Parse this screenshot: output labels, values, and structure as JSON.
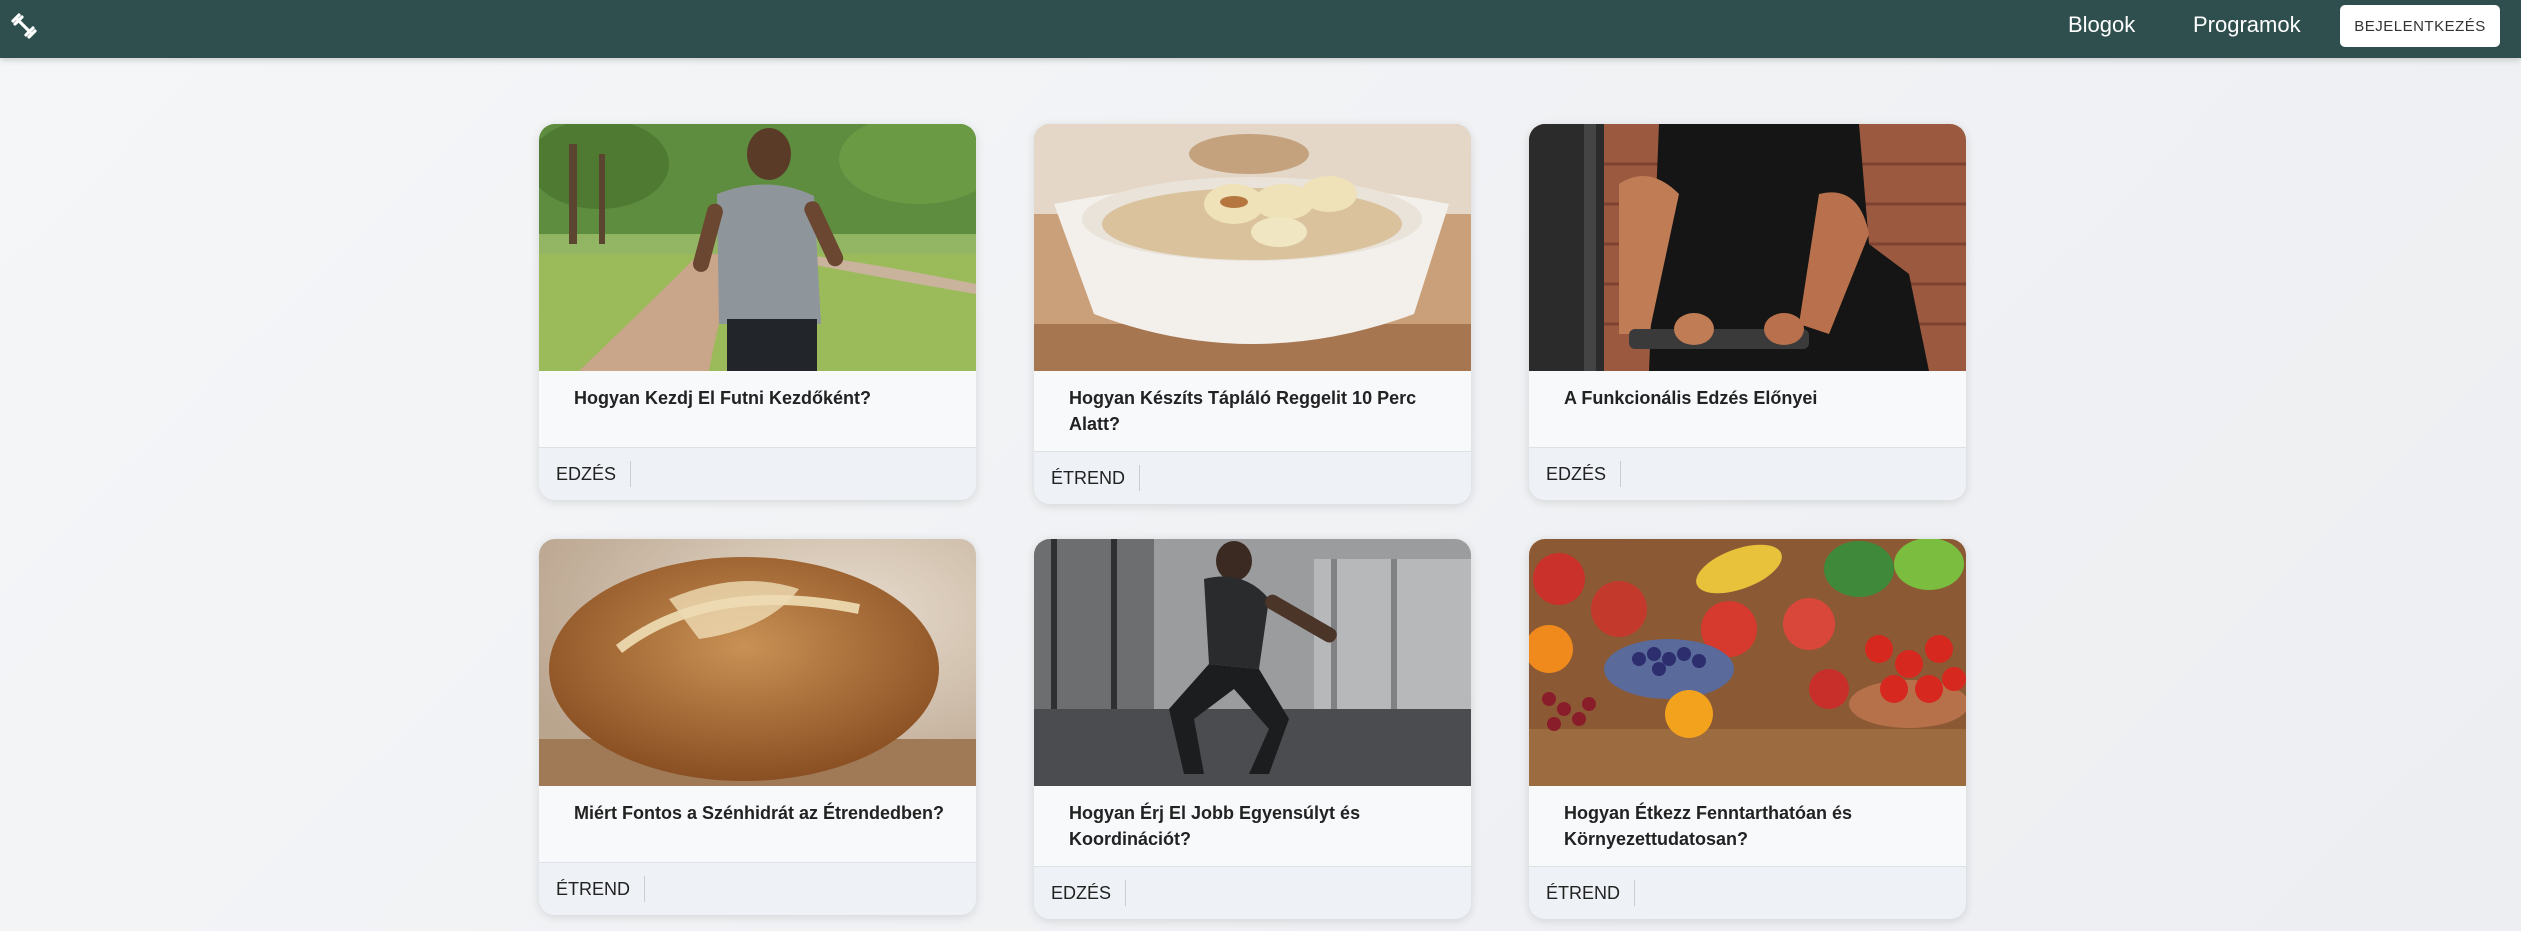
{
  "nav": {
    "logo_icon": "dumbbell-icon",
    "links": [
      "Blogok",
      "Programok"
    ],
    "login_label": "BEJELENTKEZÉS"
  },
  "cards": [
    {
      "title": "Hogyan Kezdj El Futni Kezdőként?",
      "tag": "EDZÉS",
      "image": "runner-in-park-photo"
    },
    {
      "title": "Hogyan Készíts Tápláló Reggelit 10 Perc Alatt?",
      "tag": "ÉTREND",
      "image": "oatmeal-with-banana-photo"
    },
    {
      "title": "A Funkcionális Edzés Előnyei",
      "tag": "EDZÉS",
      "image": "gym-workout-photo"
    },
    {
      "title": "Miért Fontos a Szénhidrát az Étrendedben?",
      "tag": "ÉTREND",
      "image": "bread-loaf-photo"
    },
    {
      "title": "Hogyan Érj El Jobb Egyensúlyt és Koordinációt?",
      "tag": "EDZÉS",
      "image": "balance-squat-photo"
    },
    {
      "title": "Hogyan Étkezz Fenntarthatóan és Környezettudatosan?",
      "tag": "ÉTREND",
      "image": "fruits-vegetables-photo"
    }
  ]
}
